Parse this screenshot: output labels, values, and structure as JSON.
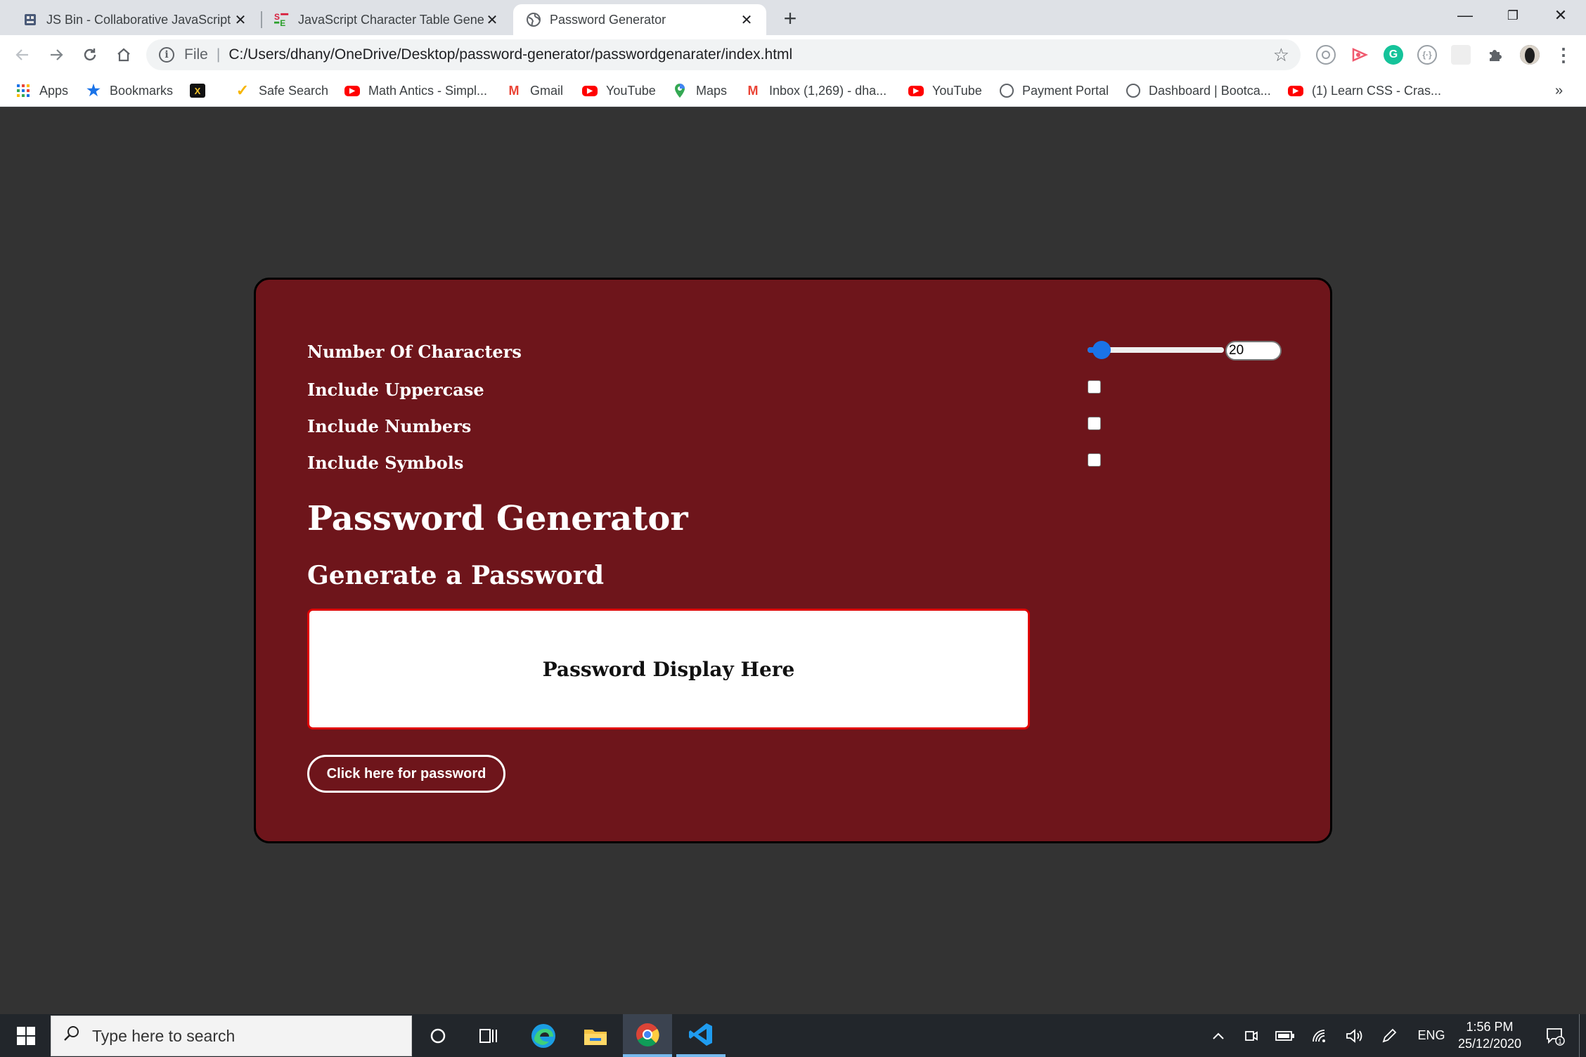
{
  "browser": {
    "tabs": [
      {
        "title": "JS Bin - Collaborative JavaScript Debugging",
        "favicon": "jsbin-icon",
        "active": false
      },
      {
        "title": "JavaScript Character Table Generator",
        "favicon": "se-icon",
        "active": false
      },
      {
        "title": "Password Generator",
        "favicon": "globe-icon",
        "active": true
      }
    ],
    "close_glyph": "✕",
    "new_tab_glyph": "+",
    "window_controls": {
      "minimize": "—",
      "restore": "❐",
      "close": "✕"
    },
    "address": {
      "scheme_label": "File",
      "info_glyph": "i",
      "url": "C:/Users/dhany/OneDrive/Desktop/password-generator/passwordgenarater/index.html",
      "star_glyph": "☆"
    },
    "bookmarks": [
      {
        "label": "Apps",
        "icon": "apps-grid-icon"
      },
      {
        "label": "Bookmarks",
        "icon": "star-icon"
      },
      {
        "label": "",
        "icon": "x-logo-icon"
      },
      {
        "label": "Safe Search",
        "icon": "check-icon"
      },
      {
        "label": "Math Antics - Simpl...",
        "icon": "youtube-icon"
      },
      {
        "label": "Gmail",
        "icon": "gmail-icon"
      },
      {
        "label": "YouTube",
        "icon": "youtube-icon"
      },
      {
        "label": "Maps",
        "icon": "maps-pin-icon"
      },
      {
        "label": "Inbox (1,269) - dha...",
        "icon": "gmail-icon"
      },
      {
        "label": "YouTube",
        "icon": "youtube-icon"
      },
      {
        "label": "Payment Portal",
        "icon": "globe-icon"
      },
      {
        "label": "Dashboard | Bootca...",
        "icon": "globe-icon"
      },
      {
        "label": "(1) Learn CSS - Cras...",
        "icon": "youtube-icon"
      }
    ],
    "more_bookmarks_glyph": "»"
  },
  "page": {
    "options": [
      {
        "label": "Number Of Characters",
        "type": "range"
      },
      {
        "label": "Include Uppercase",
        "type": "checkbox",
        "checked": false
      },
      {
        "label": "Include Numbers",
        "type": "checkbox",
        "checked": false
      },
      {
        "label": "Include Symbols",
        "type": "checkbox",
        "checked": false
      }
    ],
    "char_count": {
      "value": "20",
      "slider_fraction": 0.04
    },
    "title": "Password Generator",
    "subtitle": "Generate a Password",
    "password_display": "Password Display Here",
    "generate_button": "Click here for password",
    "colors": {
      "card": "#6e151b",
      "background": "#333333",
      "display_border": "#e00000",
      "accent": "#1a73e8"
    }
  },
  "taskbar": {
    "search_placeholder": "Type here to search",
    "language": "ENG",
    "time": "1:56 PM",
    "date": "25/12/2020",
    "notification_count": "1"
  }
}
